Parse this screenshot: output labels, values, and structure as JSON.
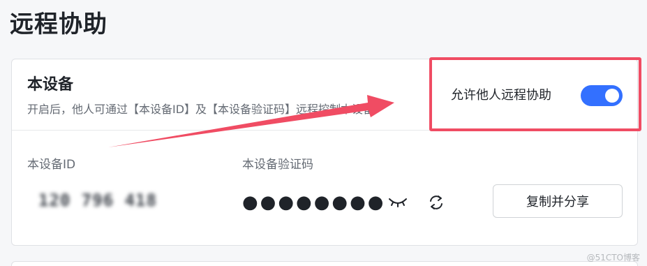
{
  "page": {
    "title": "远程协助"
  },
  "device": {
    "title": "本设备",
    "description": "开启后，他人可通过【本设备ID】及【本设备验证码】远程控制本设备",
    "remote_assist": {
      "label": "允许他人远程协助",
      "enabled": true,
      "accent_color": "#3370ff"
    },
    "id_label": "本设备ID",
    "id_value": "120 796 418",
    "code_label": "本设备验证码",
    "code_masked": "●●●●●●●●",
    "icons": {
      "reveal": "eye-closed-icon",
      "refresh": "refresh-icon"
    },
    "share_label": "复制并分享"
  },
  "annotation": {
    "color": "#f04c63"
  },
  "watermark": "@51CTO博客"
}
